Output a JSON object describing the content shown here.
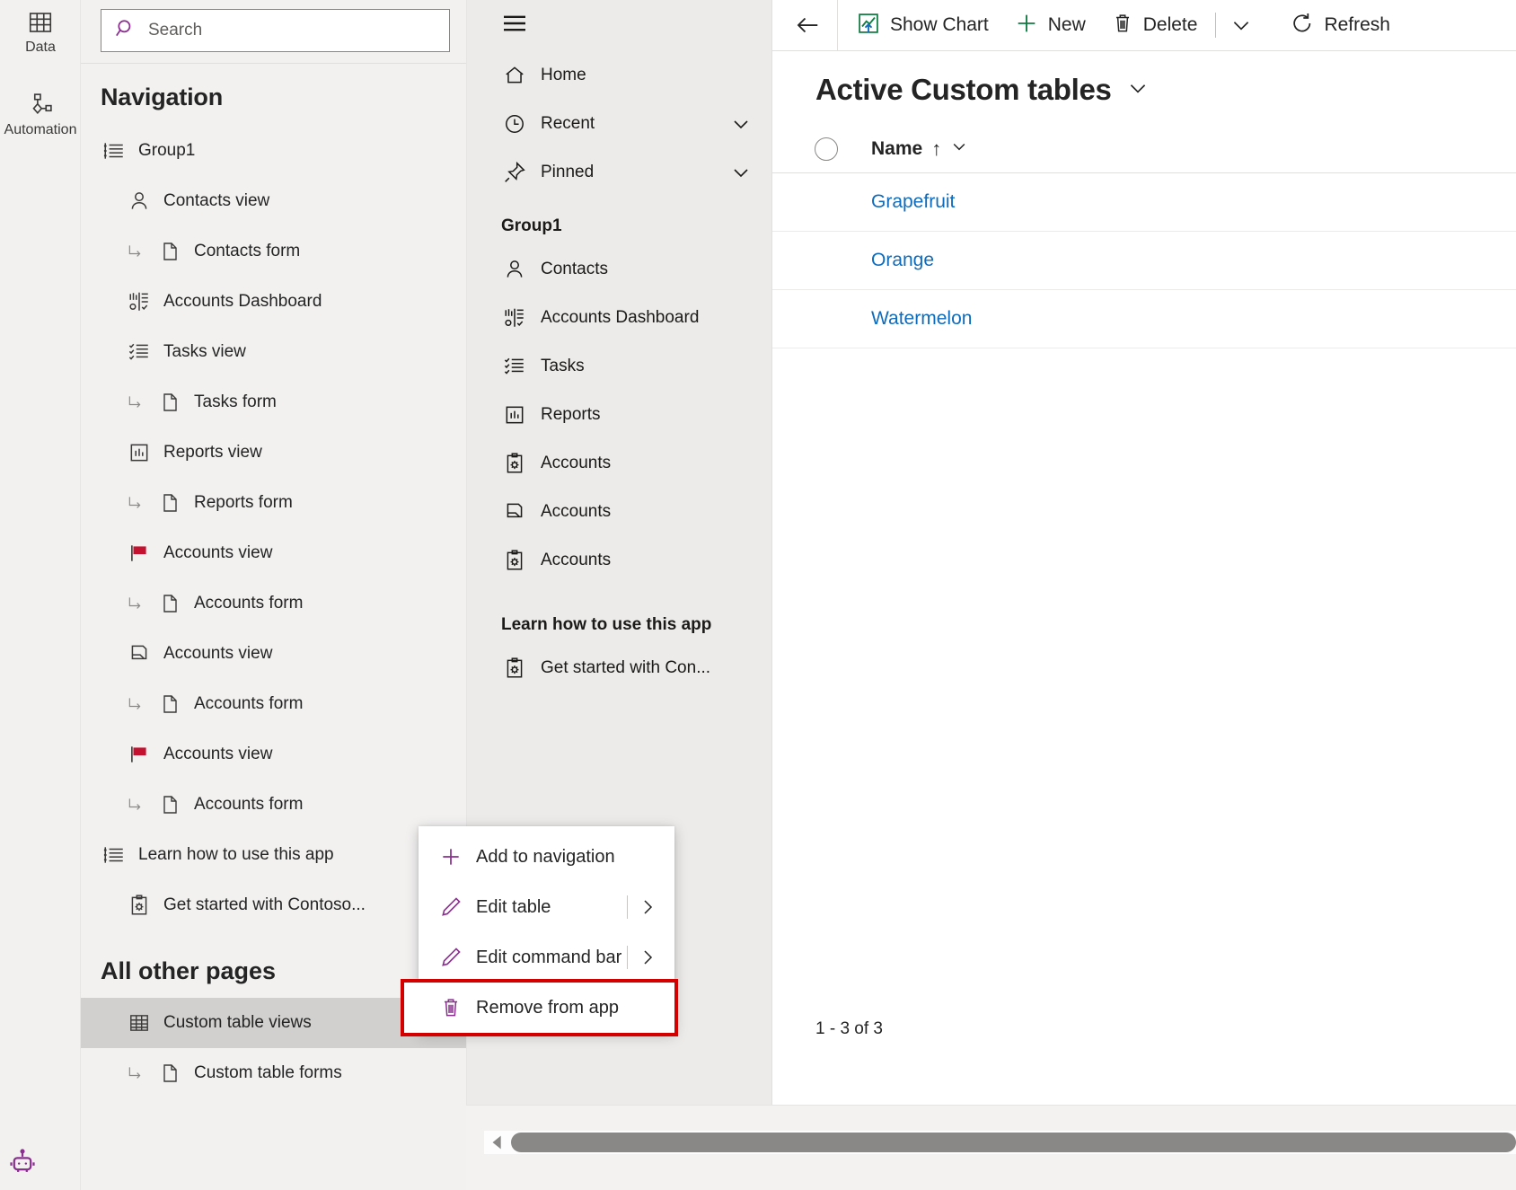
{
  "rail": {
    "items": [
      {
        "label": "Data",
        "icon": "table-icon"
      },
      {
        "label": "Automation",
        "icon": "flow-icon"
      }
    ],
    "copilot_icon": "copilot-robot-icon"
  },
  "search": {
    "placeholder": "Search",
    "icon": "search-icon"
  },
  "navigation": {
    "title": "Navigation",
    "items": [
      {
        "label": "Group1",
        "icon": "group-list-icon",
        "level": 0
      },
      {
        "label": "Contacts view",
        "icon": "contact-icon",
        "level": 1
      },
      {
        "label": "Contacts form",
        "icon": "form-page-icon",
        "level": 2
      },
      {
        "label": "Accounts Dashboard",
        "icon": "dashboard-icon",
        "level": 1
      },
      {
        "label": "Tasks view",
        "icon": "task-list-icon",
        "level": 1
      },
      {
        "label": "Tasks form",
        "icon": "form-page-icon",
        "level": 2
      },
      {
        "label": "Reports view",
        "icon": "report-chart-icon",
        "level": 1
      },
      {
        "label": "Reports form",
        "icon": "form-page-icon",
        "level": 2
      },
      {
        "label": "Accounts view",
        "icon": "red-flag-icon",
        "level": 1
      },
      {
        "label": "Accounts form",
        "icon": "form-page-icon",
        "level": 2
      },
      {
        "label": "Accounts view",
        "icon": "card-stack-icon",
        "level": 1
      },
      {
        "label": "Accounts form",
        "icon": "form-page-icon",
        "level": 2
      },
      {
        "label": "Accounts view",
        "icon": "red-flag-icon",
        "level": 1
      },
      {
        "label": "Accounts form",
        "icon": "form-page-icon",
        "level": 2
      },
      {
        "label": "Learn how to use this app",
        "icon": "group-list-icon",
        "level": 0
      },
      {
        "label": "Get started with Contoso...",
        "icon": "clipboard-gear-icon",
        "level": 1
      }
    ],
    "other_pages_title": "All other pages",
    "other_pages": [
      {
        "label": "Custom table views",
        "icon": "table-grid-icon",
        "level": 1,
        "selected": true,
        "overflow": "..."
      },
      {
        "label": "Custom table forms",
        "icon": "form-page-icon",
        "level": 2,
        "selected": false
      }
    ]
  },
  "context_menu": {
    "items": [
      {
        "label": "Add to navigation",
        "icon": "plus-icon",
        "submenu": false,
        "highlighted": false
      },
      {
        "label": "Edit table",
        "icon": "pencil-icon",
        "submenu": true,
        "highlighted": false
      },
      {
        "label": "Edit command bar",
        "icon": "pencil-icon",
        "submenu": true,
        "highlighted": false
      },
      {
        "label": "Remove from app",
        "icon": "trash-icon",
        "submenu": false,
        "highlighted": true
      }
    ],
    "highlight_color": "#d40000",
    "icon_color": "#8a2f8f"
  },
  "preview": {
    "hamburger_icon": "hamburger-icon",
    "top_items": [
      {
        "label": "Home",
        "icon": "home-icon",
        "chevron": false
      },
      {
        "label": "Recent",
        "icon": "clock-icon",
        "chevron": true
      },
      {
        "label": "Pinned",
        "icon": "pin-icon",
        "chevron": true
      }
    ],
    "group_label": "Group1",
    "group_items": [
      {
        "label": "Contacts",
        "icon": "contact-icon"
      },
      {
        "label": "Accounts Dashboard",
        "icon": "dashboard-icon"
      },
      {
        "label": "Tasks",
        "icon": "task-list-icon"
      },
      {
        "label": "Reports",
        "icon": "report-chart-icon"
      },
      {
        "label": "Accounts",
        "icon": "clipboard-gear-icon"
      },
      {
        "label": "Accounts",
        "icon": "card-stack-icon"
      },
      {
        "label": "Accounts",
        "icon": "clipboard-gear-icon"
      }
    ],
    "learn_label": "Learn how to use this app",
    "learn_items": [
      {
        "label": "Get started with Con...",
        "icon": "clipboard-gear-icon"
      }
    ]
  },
  "content": {
    "commandbar": {
      "back_icon": "back-arrow-icon",
      "buttons": [
        {
          "label": "Show Chart",
          "icon": "chart-icon"
        },
        {
          "label": "New",
          "icon": "plus-icon"
        },
        {
          "label": "Delete",
          "icon": "trash-icon"
        }
      ],
      "overflow_chevron": "chevron-down-icon",
      "refresh": {
        "label": "Refresh",
        "icon": "refresh-icon"
      }
    },
    "view_title": "Active Custom tables",
    "view_chevron": "chevron-down-icon",
    "grid": {
      "select_all": "select-all-circle",
      "columns": [
        {
          "label": "Name",
          "sort": "↑",
          "chevron": "chevron-down-icon"
        }
      ],
      "rows": [
        {
          "name": "Grapefruit"
        },
        {
          "name": "Orange"
        },
        {
          "name": "Watermelon"
        }
      ]
    },
    "footer_count": "1 - 3 of 3"
  },
  "colors": {
    "accent_purple": "#8a2f8f",
    "link_blue": "#0f6cbd",
    "highlight_red": "#d40000",
    "new_green": "#107c41"
  }
}
